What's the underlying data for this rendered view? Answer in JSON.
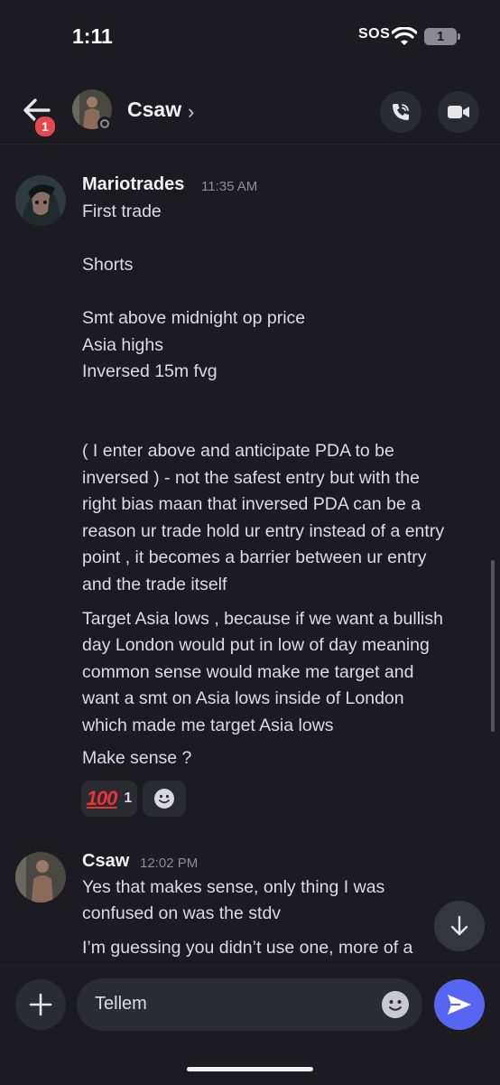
{
  "status_bar": {
    "time": "1:11",
    "sos": "SOS",
    "battery_level": "1"
  },
  "header": {
    "unread_count": "1",
    "channel_name": "Csaw",
    "chevron": "›",
    "icons": [
      "back-arrow-icon",
      "phone-icon",
      "video-camera-icon"
    ]
  },
  "messages": [
    {
      "author": "Mariotrades",
      "time": "11:35 AM",
      "lines": [
        "First trade",
        "Shorts",
        "Smt above midnight op price",
        "Asia highs",
        "Inversed 15m fvg",
        "( I enter above and anticipate PDA to be",
        "inversed ) - not the safest entry but with the",
        "right bias maan that inversed PDA can be a",
        "reason ur trade hold ur entry instead of a entry",
        "point , it becomes a barrier between ur entry",
        "and the trade itself",
        "Target Asia lows , because if we want a bullish",
        "day London would put in low of day meaning",
        "common sense would make me target and",
        "want a smt on Asia lows inside of London",
        "which made me target Asia lows",
        "Make sense ?"
      ],
      "reaction": {
        "emoji": "100",
        "count": "1"
      }
    },
    {
      "author": "Csaw",
      "time": "12:02 PM",
      "lines": [
        "Yes that makes sense, only thing I was",
        "confused on was the stdv",
        "I’m guessing you didn’t use one, more of a"
      ]
    }
  ],
  "composer": {
    "text": "Tellem"
  },
  "colors": {
    "background": "#1b1b21",
    "send": "#5865f2",
    "badge": "#e5484d"
  }
}
